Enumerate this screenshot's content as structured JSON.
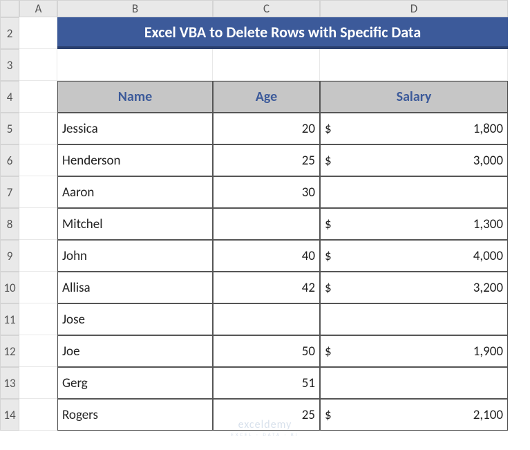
{
  "columns": [
    "A",
    "B",
    "C",
    "D"
  ],
  "rows": [
    "2",
    "3",
    "4",
    "5",
    "6",
    "7",
    "8",
    "9",
    "10",
    "11",
    "12",
    "13",
    "14"
  ],
  "title": "Excel VBA to Delete Rows with Specific Data",
  "headers": {
    "name": "Name",
    "age": "Age",
    "salary": "Salary"
  },
  "data": [
    {
      "name": "Jessica",
      "age": "20",
      "salary": "1,800",
      "has_salary": true
    },
    {
      "name": "Henderson",
      "age": "25",
      "salary": "3,000",
      "has_salary": true
    },
    {
      "name": "Aaron",
      "age": "30",
      "salary": "",
      "has_salary": false
    },
    {
      "name": "Mitchel",
      "age": "",
      "salary": "1,300",
      "has_salary": true
    },
    {
      "name": "John",
      "age": "40",
      "salary": "4,000",
      "has_salary": true
    },
    {
      "name": "Allisa",
      "age": "42",
      "salary": "3,200",
      "has_salary": true
    },
    {
      "name": "Jose",
      "age": "",
      "salary": "",
      "has_salary": false
    },
    {
      "name": "Joe",
      "age": "50",
      "salary": "1,900",
      "has_salary": true
    },
    {
      "name": "Gerg",
      "age": "51",
      "salary": "",
      "has_salary": false
    },
    {
      "name": "Rogers",
      "age": "25",
      "salary": "2,100",
      "has_salary": true
    }
  ],
  "currency": "$",
  "watermark": {
    "main": "exceldemy",
    "sub": "EXCEL · DATA · BI"
  },
  "chart_data": {
    "type": "table",
    "title": "Excel VBA to Delete Rows with Specific Data",
    "columns": [
      "Name",
      "Age",
      "Salary"
    ],
    "rows": [
      [
        "Jessica",
        20,
        1800
      ],
      [
        "Henderson",
        25,
        3000
      ],
      [
        "Aaron",
        30,
        null
      ],
      [
        "Mitchel",
        null,
        1300
      ],
      [
        "John",
        40,
        4000
      ],
      [
        "Allisa",
        42,
        3200
      ],
      [
        "Jose",
        null,
        null
      ],
      [
        "Joe",
        50,
        1900
      ],
      [
        "Gerg",
        51,
        null
      ],
      [
        "Rogers",
        25,
        2100
      ]
    ]
  }
}
